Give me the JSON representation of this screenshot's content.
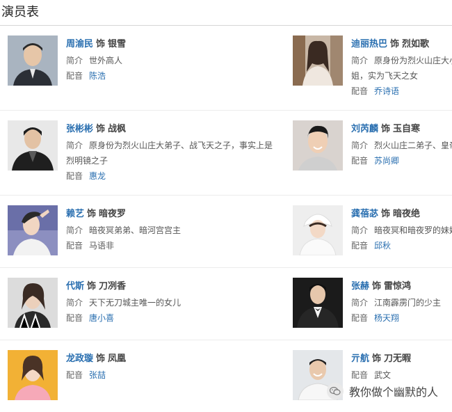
{
  "page": {
    "title": "演员表"
  },
  "labels": {
    "as": "饰",
    "intro": "简介",
    "voice": "配音"
  },
  "cast": [
    {
      "actor": "周渝民",
      "role": "银雪",
      "intro": "世外高人",
      "voice": "陈浩",
      "voice_link": true
    },
    {
      "actor": "迪丽热巴",
      "role": "烈如歌",
      "intro": "原身份为烈火山庄大小姐，实为飞天之女",
      "voice": "乔诗语",
      "voice_link": true
    },
    {
      "actor": "张彬彬",
      "role": "战枫",
      "intro": "原身份为烈火山庄大弟子、战飞天之子，事实上是烈明镜之子",
      "voice": "惠龙",
      "voice_link": true
    },
    {
      "actor": "刘芮麟",
      "role": "玉自寒",
      "intro": "烈火山庄二弟子、皇帝",
      "voice": "苏尚卿",
      "voice_link": true
    },
    {
      "actor": "赖艺",
      "role": "暗夜罗",
      "intro": "暗夜冥弟弟、暗河宫宫主",
      "voice": "马语非",
      "voice_link": false
    },
    {
      "actor": "龚蓓苾",
      "role": "暗夜绝",
      "intro": "暗夜冥和暗夜罗的妹妹",
      "voice": "邱秋",
      "voice_link": true
    },
    {
      "actor": "代斯",
      "role": "刀冽香",
      "intro": "天下无刀城主唯一的女儿",
      "voice": "唐小喜",
      "voice_link": true
    },
    {
      "actor": "张赫",
      "role": "雷惊鸿",
      "intro": "江南霹雳门的少主",
      "voice": "杨天翔",
      "voice_link": true
    },
    {
      "actor": "龙政璇",
      "role": "凤凰",
      "intro": "",
      "voice": "张喆",
      "voice_link": true
    },
    {
      "actor": "亓航",
      "role": "刀无暇",
      "intro": "",
      "voice": "武文",
      "voice_link": false
    }
  ],
  "watermark": {
    "text": "教你做个幽默的人",
    "icon": "wechat-icon"
  }
}
